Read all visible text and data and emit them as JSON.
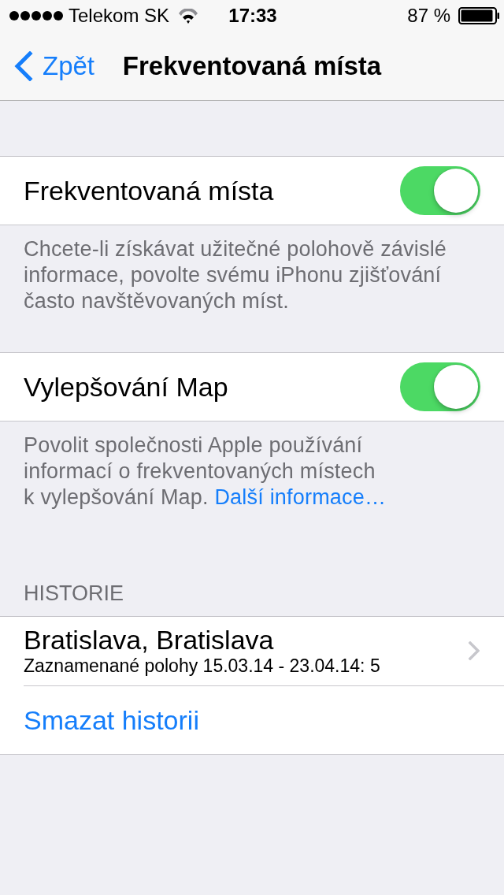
{
  "status_bar": {
    "carrier": "Telekom SK",
    "time": "17:33",
    "battery": "87 %"
  },
  "nav_bar": {
    "back": "Zpět",
    "title": "Frekventovaná místa"
  },
  "sections": [
    {
      "kind": "toggle",
      "label": "Frekventovaná místa",
      "on": true,
      "footer": "Chcete-li získávat užitečné polohově závislé informace, povolte svému iPhonu zjišťování často navštěvovaných míst."
    },
    {
      "kind": "toggle",
      "label": "Vylepšování Map",
      "on": true,
      "footer": "Povolit společnosti Apple používání informací o frekventovaných místech k vylepšování Map.",
      "footer_link": "Další informace…"
    }
  ],
  "history": {
    "header": "HISTORIE",
    "items": [
      {
        "kind": "location",
        "title": "Bratislava, Bratislava",
        "subtitle": "Zaznamenané polohy 15.03.14 - 23.04.14: 5"
      },
      {
        "kind": "action",
        "label": "Smazat historii"
      }
    ]
  }
}
